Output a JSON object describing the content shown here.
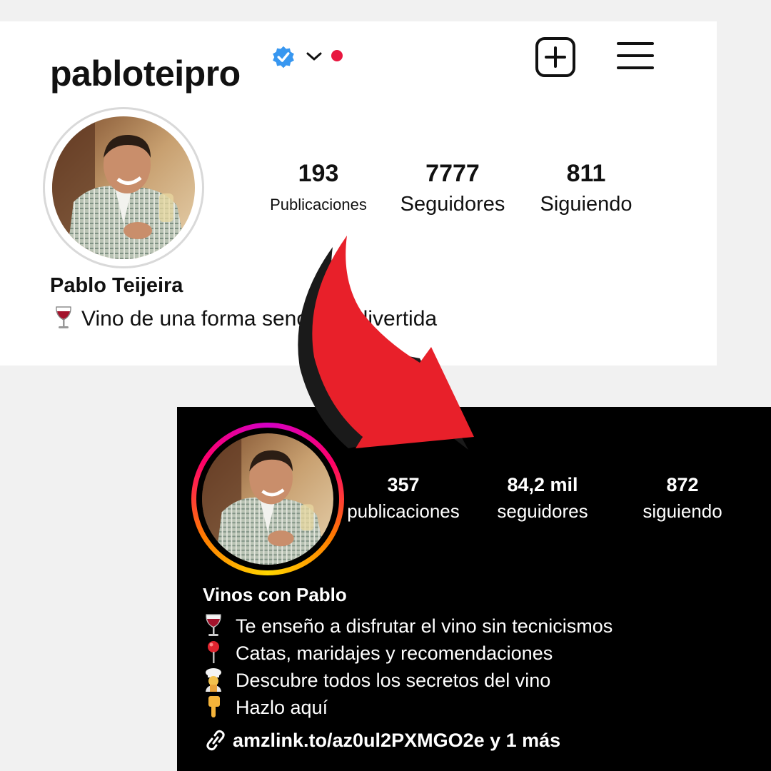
{
  "top_profile": {
    "username": "pabloteipro",
    "stats": [
      {
        "value": "193",
        "label": "Publicaciones"
      },
      {
        "value": "7777",
        "label": "Seguidores"
      },
      {
        "value": "811",
        "label": "Siguiendo"
      }
    ],
    "name": "Pablo Teijeira",
    "bio": "Vino de una forma sencilla y divertida",
    "bio_icon": "wine-glass-icon"
  },
  "bottom_profile": {
    "stats": [
      {
        "value": "357",
        "label": "publicaciones"
      },
      {
        "value": "84,2 mil",
        "label": "seguidores"
      },
      {
        "value": "872",
        "label": "siguiendo"
      }
    ],
    "name": "Vinos con Pablo",
    "bio_lines": [
      {
        "icon": "wine-glass-icon",
        "text": "Te enseño a disfrutar el vino sin tecnicismos"
      },
      {
        "icon": "pushpin-icon",
        "text": "Catas, maridajes y recomendaciones"
      },
      {
        "icon": "chef-icon",
        "text": "Descubre todos los secretos del vino"
      },
      {
        "icon": "pointing-down-icon",
        "text": "Hazlo aquí"
      }
    ],
    "link": "amzlink.to/az0ul2PXMGO2e y 1 más"
  },
  "colors": {
    "verified": "#3897f0",
    "notification_dot": "#e8173f",
    "arrow": "#e8202a",
    "dark_background": "#000000"
  }
}
